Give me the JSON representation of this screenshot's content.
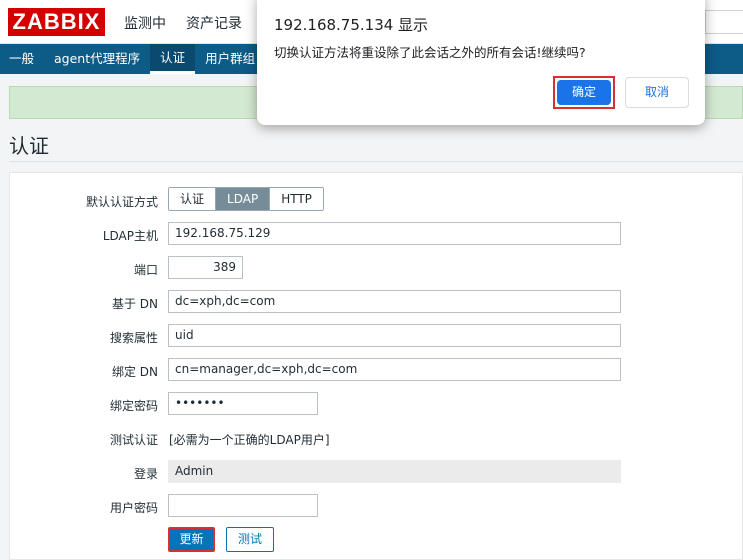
{
  "header": {
    "logo_text": "ZABBIX",
    "nav": [
      "监测中",
      "资产记录"
    ]
  },
  "sub_nav": {
    "items": [
      "一般",
      "agent代理程序",
      "认证",
      "用户群组"
    ],
    "active": "认证"
  },
  "page": {
    "title": "认证"
  },
  "form": {
    "auth_method_label": "默认认证方式",
    "auth_options": [
      "认证",
      "LDAP",
      "HTTP"
    ],
    "auth_selected": "LDAP",
    "ldap_host_label": "LDAP主机",
    "ldap_host_value": "192.168.75.129",
    "port_label": "端口",
    "port_value": "389",
    "base_dn_label": "基于 DN",
    "base_dn_value": "dc=xph,dc=com",
    "search_attr_label": "搜索属性",
    "search_attr_value": "uid",
    "bind_dn_label": "绑定 DN",
    "bind_dn_value": "cn=manager,dc=xph,dc=com",
    "bind_password_label": "绑定密码",
    "bind_password_value": "•••••••",
    "test_auth_label": "测试认证",
    "test_auth_note": "[必需为一个正确的LDAP用户]",
    "login_label": "登录",
    "login_value": "Admin",
    "user_password_label": "用户密码",
    "user_password_value": "",
    "update_button": "更新",
    "test_button": "测试"
  },
  "dialog": {
    "title": "192.168.75.134 显示",
    "message": "切换认证方法将重设除了此会话之外的所有会话!继续吗?",
    "ok": "确定",
    "cancel": "取消"
  },
  "colors": {
    "brand": "#d40000",
    "nav_bar": "#0d5b87",
    "primary_button": "#0275b8",
    "highlight_outline": "#d63031",
    "dialog_ok": "#1a73e8"
  }
}
